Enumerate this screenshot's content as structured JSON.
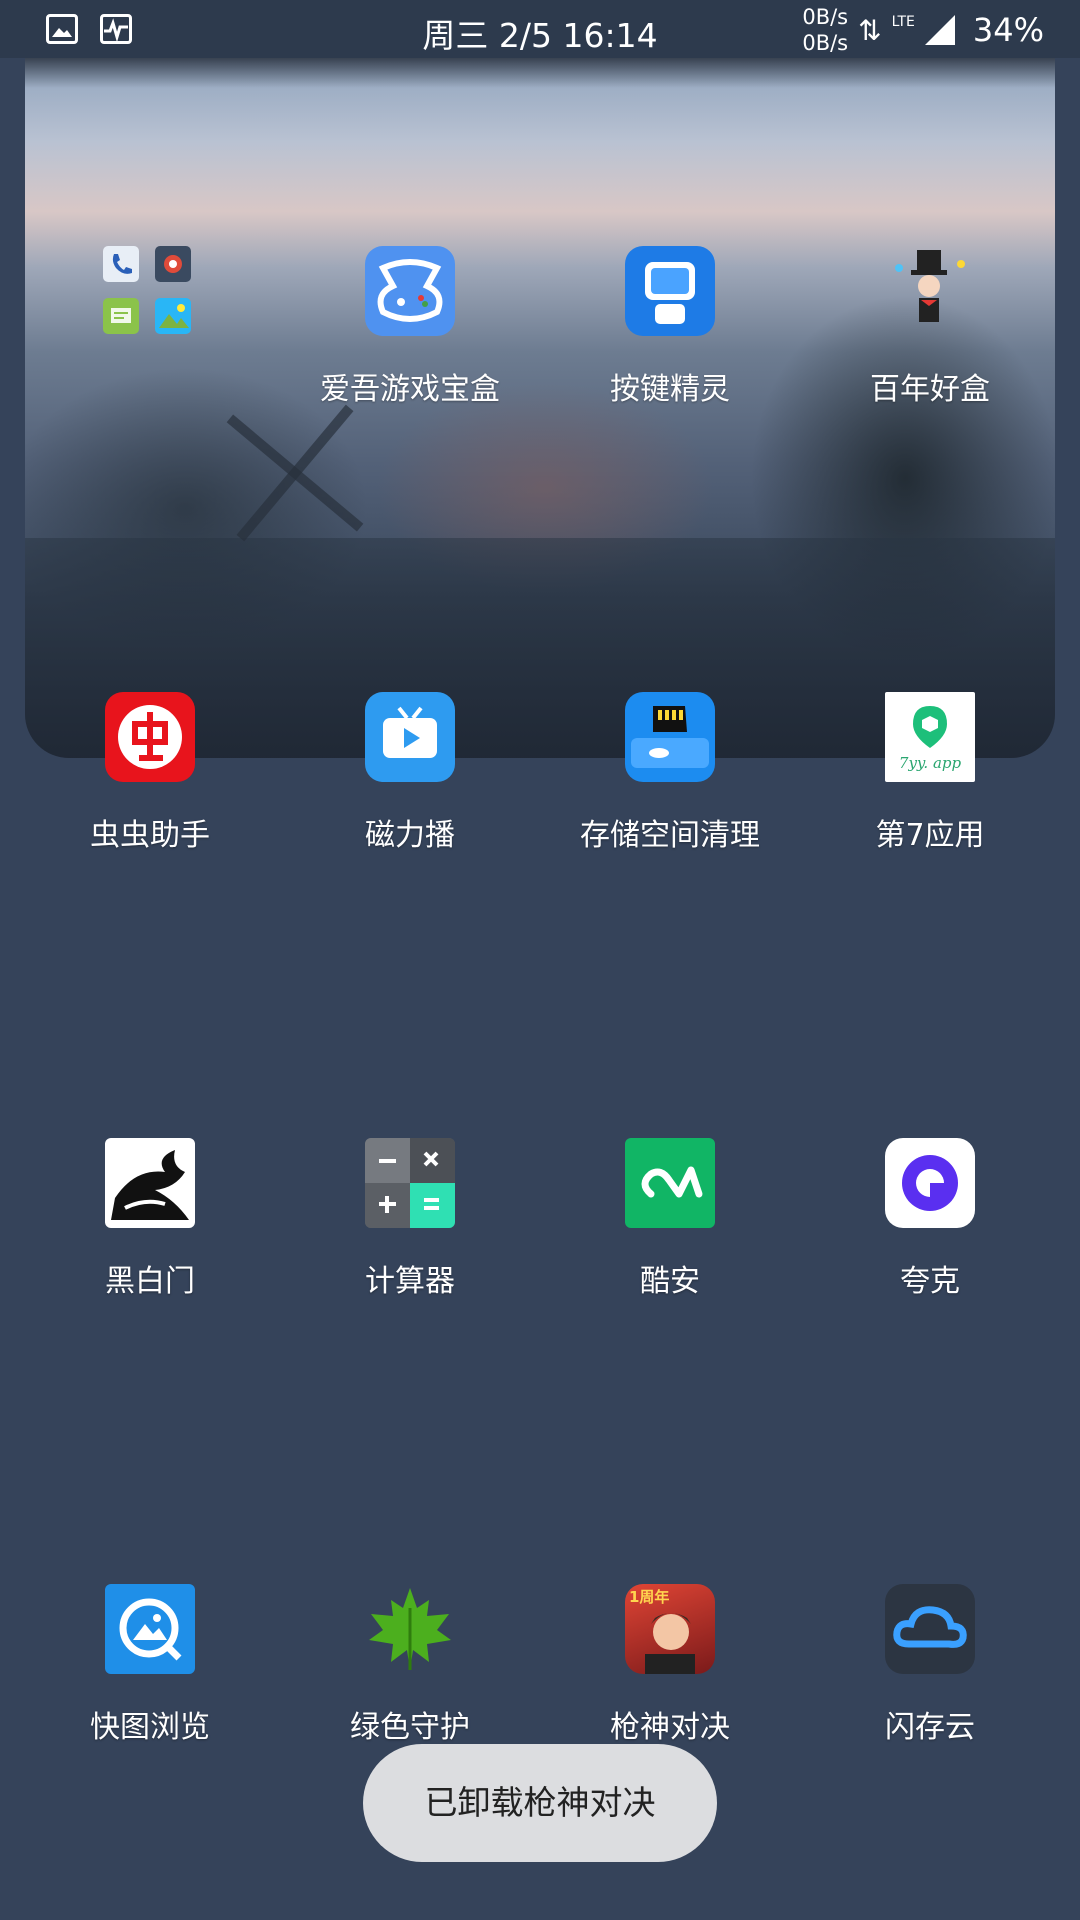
{
  "status_bar": {
    "datetime": "周三 2/5 16:14",
    "net_up": "0B/s",
    "net_down": "0B/s",
    "network_type": "LTE",
    "battery": "34%",
    "left_icons": [
      "image-icon",
      "activity-icon"
    ]
  },
  "apps": [
    {
      "label": "爱吾游戏宝盒",
      "icon": "gamepad-box-icon"
    },
    {
      "label": "按键精灵",
      "icon": "robot-icon"
    },
    {
      "label": "百年好盒",
      "icon": "magician-icon"
    },
    {
      "label": "虫虫助手",
      "icon": "bug-char-icon"
    },
    {
      "label": "磁力播",
      "icon": "tv-play-icon"
    },
    {
      "label": "存储空间清理",
      "icon": "sd-card-clean-icon"
    },
    {
      "label": "第7应用",
      "icon": "cube-7yy-icon",
      "icon_text": "7yy. app"
    },
    {
      "label": "黑白门",
      "icon": "dragon-icon"
    },
    {
      "label": "计算器",
      "icon": "calculator-icon"
    },
    {
      "label": "酷安",
      "icon": "coolapk-icon"
    },
    {
      "label": "夸克",
      "icon": "quark-icon"
    },
    {
      "label": "快图浏览",
      "icon": "gallery-q-icon"
    },
    {
      "label": "绿色守护",
      "icon": "maple-leaf-icon"
    },
    {
      "label": "枪神对决",
      "icon": "game-hero-icon",
      "icon_text": "1周年"
    },
    {
      "label": "闪存云",
      "icon": "cloud-icon"
    }
  ],
  "folder": {
    "icons": [
      "phone-icon",
      "camera-icon",
      "message-icon",
      "gallery-icon"
    ]
  },
  "toast": {
    "text": "已卸载枪神对决"
  },
  "colors": {
    "background": "#35435a",
    "status_bar": "#2d3a4d",
    "toast_bg": "#dcdde0"
  }
}
